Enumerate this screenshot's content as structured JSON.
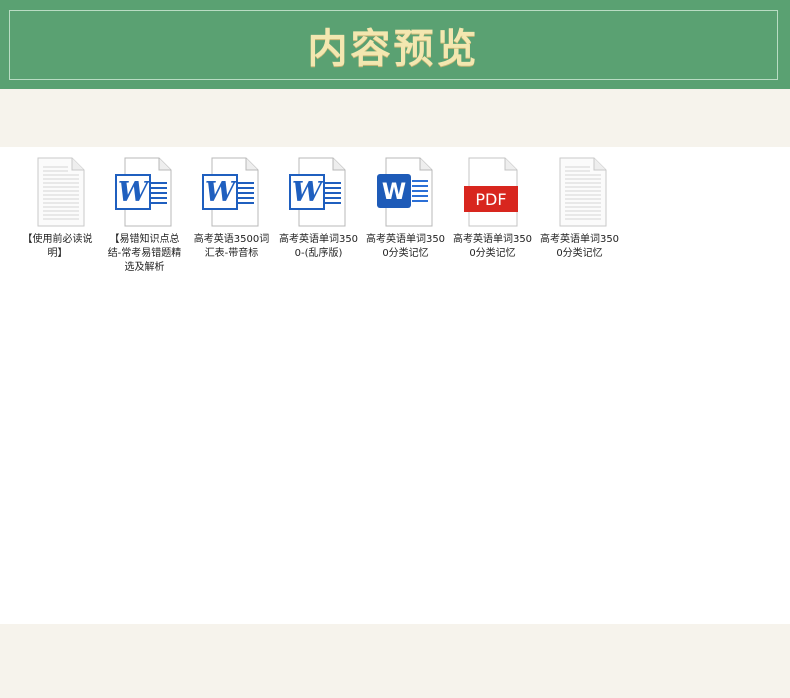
{
  "header": {
    "title": "内容预览"
  },
  "files": [
    {
      "label": "【使用前必读说明】",
      "icon": "text-document-icon",
      "type": "txt"
    },
    {
      "label": "【易错知识点总结-常考易错题精选及解析",
      "icon": "word-document-icon",
      "type": "word-old"
    },
    {
      "label": "高考英语3500词汇表-带音标",
      "icon": "word-document-icon",
      "type": "word-old"
    },
    {
      "label": "高考英语单词3500-(乱序版)",
      "icon": "word-document-icon",
      "type": "word-old"
    },
    {
      "label": "高考英语单词3500分类记忆",
      "icon": "word-document-icon",
      "type": "word-new"
    },
    {
      "label": "高考英语单词3500分类记忆",
      "icon": "pdf-document-icon",
      "type": "pdf",
      "badge": "PDF"
    },
    {
      "label": "高考英语单词3500分类记忆",
      "icon": "text-document-icon",
      "type": "txt"
    }
  ],
  "colors": {
    "banner": "#5aa172",
    "title": "#f3e7b0",
    "word_blue": "#1f5fbf",
    "pdf_red": "#d8261e"
  }
}
